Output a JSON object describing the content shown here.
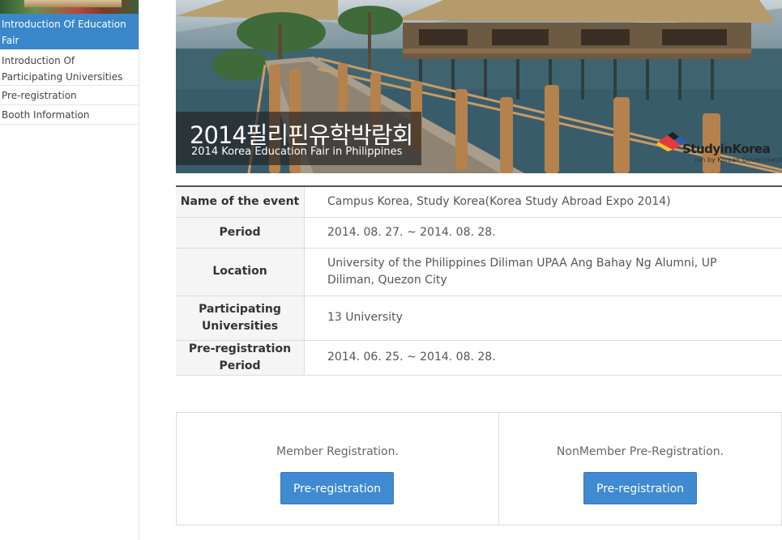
{
  "sidebar": {
    "items": [
      {
        "label": "Introduction Of Education Fair",
        "active": true
      },
      {
        "label": "Introduction Of Participating Universities",
        "active": false
      },
      {
        "label": "Pre-registration",
        "active": false
      },
      {
        "label": "Booth Information",
        "active": false
      }
    ]
  },
  "banner": {
    "title_ko": "2014필리핀유학박람회",
    "title_en": "2014 Korea Education Fair in Philippines",
    "logo_text": "StudyinKorea",
    "logo_sub": "run by Korean Government"
  },
  "event_info": {
    "rows": [
      {
        "label": "Name of the event",
        "value": "Campus Korea, Study Korea(Korea Study Abroad Expo 2014)"
      },
      {
        "label": "Period",
        "value": "2014. 08. 27. ~ 2014. 08. 28."
      },
      {
        "label": "Location",
        "value": "University of the Philippines Diliman UPAA Ang Bahay Ng Alumni, UP Diliman, Quezon City"
      },
      {
        "label": "Participating Universities",
        "value": "13 University"
      },
      {
        "label": "Pre-registration Period",
        "value": "2014. 06. 25. ~ 2014. 08. 28."
      }
    ]
  },
  "registration": {
    "member": {
      "label": "Member Registration.",
      "button": "Pre-registration"
    },
    "nonmember": {
      "label": "NonMember Pre-Registration.",
      "button": "Pre-registration"
    }
  },
  "colors": {
    "accent": "#3a87c9",
    "button": "#3f8ad0"
  }
}
